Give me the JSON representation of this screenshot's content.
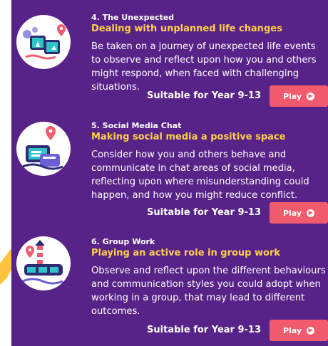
{
  "colors": {
    "panel": "#582389",
    "accent_title": "#ffcf4a",
    "play_button": "#f25a6e",
    "deco": "#ffc43d"
  },
  "modules": [
    {
      "number": "4. The Unexpected",
      "title": "Dealing with unplanned life changes",
      "description": "Be taken on a journey of unexpected life events to observe and reflect upon how you and others might respond, when faced with challenging situations.",
      "suitable": "Suitable for Year 9-13",
      "play_label": "Play",
      "icon": "unexpected-journey-illustration-icon"
    },
    {
      "number": "5. Social Media Chat",
      "title": "Making social media a positive space",
      "description": "Consider how you and others behave and communicate in chat areas of social media, reflecting upon where misunderstanding could happen, and how you might reduce conflict.",
      "suitable": "Suitable for Year 9-13",
      "play_label": "Play",
      "icon": "social-media-chat-illustration-icon"
    },
    {
      "number": "6. Group Work",
      "title": "Playing an active role in group work",
      "description": "Observe and reflect upon the different behaviours and communication styles you could adopt when working in a group, that may lead to different outcomes.",
      "suitable": "Suitable for Year 9-13",
      "play_label": "Play",
      "icon": "group-work-illustration-icon"
    }
  ]
}
